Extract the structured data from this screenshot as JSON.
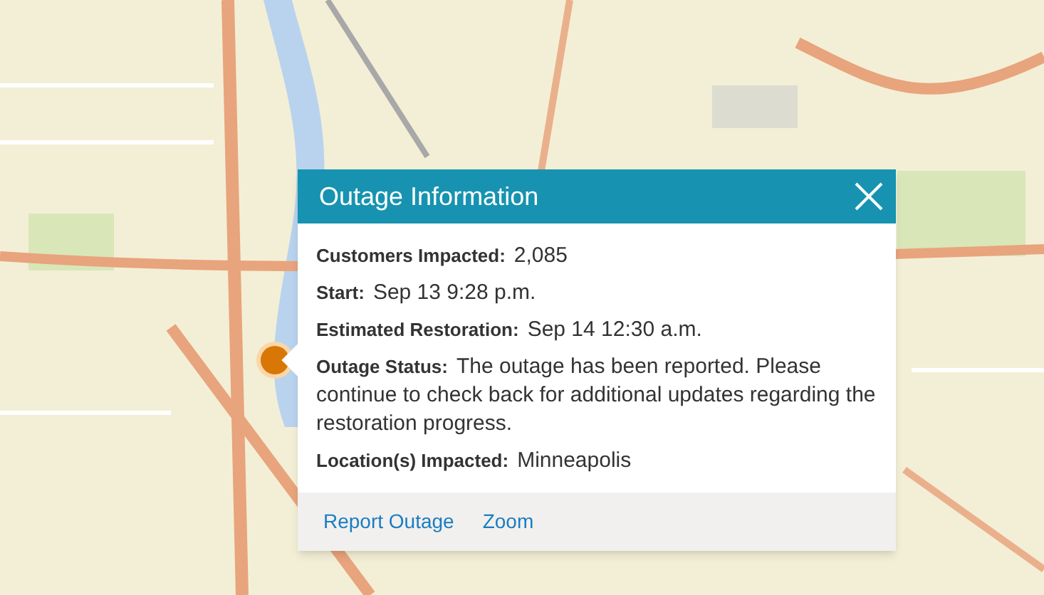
{
  "popup": {
    "title": "Outage Information",
    "fields": [
      {
        "label": "Customers Impacted:",
        "value": "2,085"
      },
      {
        "label": "Start:",
        "value": "Sep 13 9:28 p.m."
      },
      {
        "label": "Estimated Restoration:",
        "value": "Sep 14 12:30 a.m."
      },
      {
        "label": "Outage Status:",
        "value": "The outage has been reported. Please continue to check back for additional updates regarding the restoration progress."
      },
      {
        "label": "Location(s) Impacted:",
        "value": "Minneapolis"
      }
    ],
    "links": [
      "Report Outage",
      "Zoom"
    ]
  }
}
